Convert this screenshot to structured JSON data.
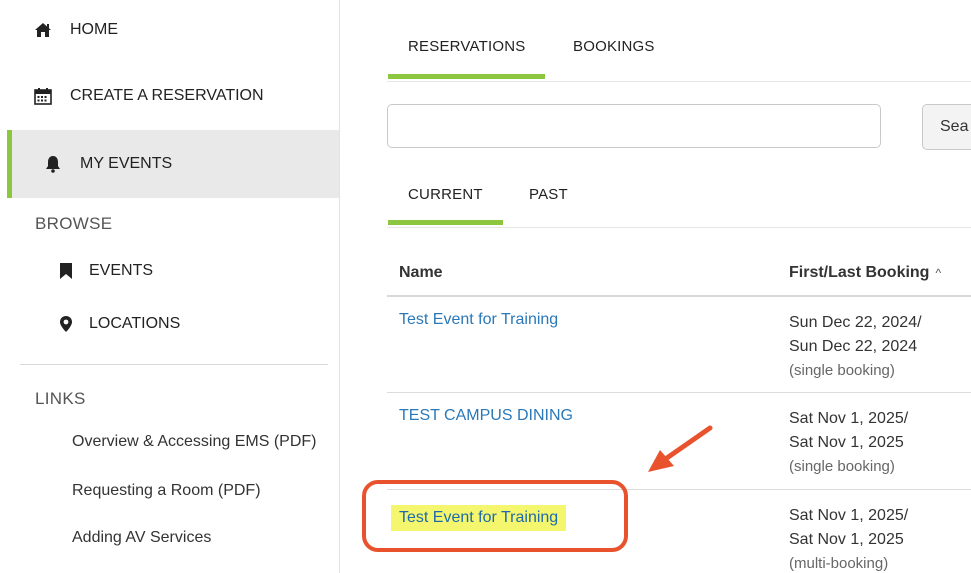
{
  "sidebar": {
    "home": "HOME",
    "create": "CREATE A RESERVATION",
    "my_events": "MY EVENTS",
    "browse_header": "BROWSE",
    "events": "EVENTS",
    "locations": "LOCATIONS",
    "links_header": "LINKS",
    "links": [
      "Overview & Accessing EMS (PDF)",
      "Requesting a Room (PDF)",
      "Adding AV Services"
    ]
  },
  "main": {
    "tabs": [
      "RESERVATIONS",
      "BOOKINGS"
    ],
    "search": {
      "value": "",
      "button": "Sea"
    },
    "subtabs": [
      "CURRENT",
      "PAST"
    ],
    "columns": {
      "name": "Name",
      "booking": "First/Last Booking"
    },
    "rows": [
      {
        "name": "Test Event for Training",
        "first": "Sun Dec 22, 2024/",
        "last": "Sun Dec 22, 2024",
        "note": "(single booking)"
      },
      {
        "name": "TEST CAMPUS DINING",
        "first": "Sat Nov 1, 2025/",
        "last": "Sat Nov 1, 2025",
        "note": "(single booking)"
      },
      {
        "name": "Test Event for Training",
        "first": "Sat Nov 1, 2025/",
        "last": "Sat Nov 1, 2025",
        "note": "(multi-booking)"
      }
    ]
  },
  "colors": {
    "accent_green": "#8dc63f",
    "link_blue": "#2a78b8",
    "annotation": "#e8532e",
    "highlight": "#f4f76e"
  },
  "icons": {
    "home": "home-icon",
    "create": "calendar-icon",
    "my_events": "bell-icon",
    "events": "bookmark-icon",
    "locations": "map-marker-icon",
    "sort": "caret-up-icon"
  }
}
